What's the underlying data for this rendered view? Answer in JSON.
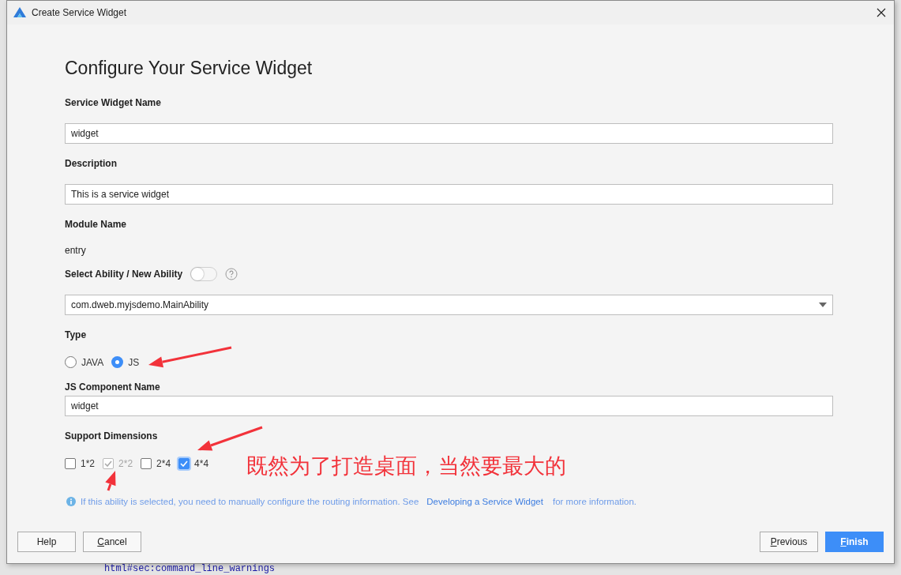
{
  "window": {
    "title": "Create Service Widget"
  },
  "heading": "Configure Your Service Widget",
  "fields": [
    {
      "kind": "text",
      "label": "Service Widget Name",
      "value": "widget"
    },
    {
      "kind": "text",
      "label": "Description",
      "value": "This is a service widget"
    },
    {
      "kind": "static",
      "label": "Module Name",
      "value": "entry"
    },
    {
      "kind": "select",
      "label": "Select Ability / New Ability",
      "toggle_on": false,
      "value": "com.dweb.myjsdemo.MainAbility"
    },
    {
      "kind": "radio",
      "label": "Type",
      "options": [
        {
          "label": "JAVA",
          "selected": false
        },
        {
          "label": "JS",
          "selected": true
        }
      ]
    },
    {
      "kind": "text",
      "label": "JS Component Name",
      "value": "widget"
    },
    {
      "kind": "checks",
      "label": "Support Dimensions",
      "options": [
        {
          "label": "1*2",
          "checked": false,
          "disabled": false
        },
        {
          "label": "2*2",
          "checked": true,
          "disabled": true
        },
        {
          "label": "2*4",
          "checked": false,
          "disabled": false
        },
        {
          "label": "4*4",
          "checked": true,
          "disabled": false
        }
      ]
    }
  ],
  "info": {
    "before": "If this ability is selected, you need to manually configure the routing information. See",
    "link": "Developing a Service Widget",
    "after": "for more information."
  },
  "buttons_left": [
    {
      "label": "Help",
      "mnemonic": false,
      "primary": false
    },
    {
      "label": "Cancel",
      "mnemonic": true,
      "primary": false
    }
  ],
  "buttons_right": [
    {
      "label": "Previous",
      "mnemonic": true,
      "primary": false
    },
    {
      "label": "Finish",
      "mnemonic": true,
      "primary": true
    }
  ],
  "annotation": {
    "note": "既然为了打造桌面，当然要最大的"
  },
  "background": {
    "code_line": "html#sec:command_line_warnings"
  }
}
